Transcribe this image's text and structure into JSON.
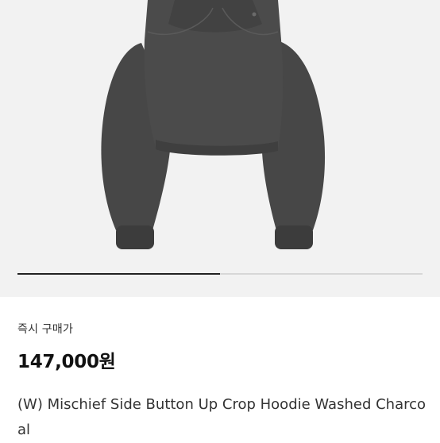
{
  "carousel": {
    "progress": 0.5
  },
  "product": {
    "image_subject": "charcoal-crop-hoodie",
    "price_label": "즉시 구매가",
    "price": "147,000원",
    "title": "(W) Mischief Side Button Up Crop Hoodie Washed Charcoal"
  },
  "colors": {
    "image_background": "#f2f2f2",
    "garment": "#4a4a4a",
    "text_primary": "#111111"
  }
}
